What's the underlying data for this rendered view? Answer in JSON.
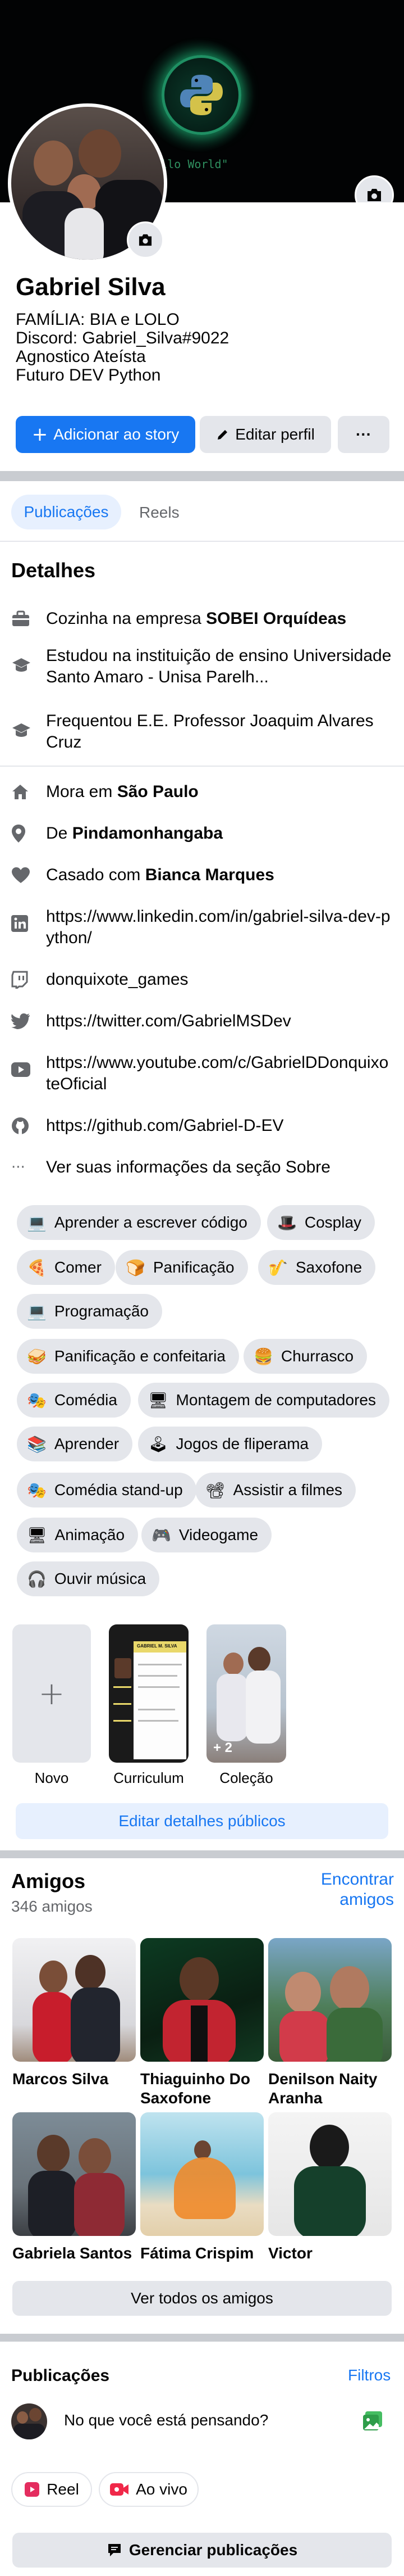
{
  "cover": {
    "code_text": "t \"Hello World\""
  },
  "profile": {
    "name": "Gabriel Silva",
    "bio": [
      "FAMÍLIA: BIA e LOLO",
      "Discord: Gabriel_Silva#9022",
      "Agnostico Ateísta",
      "Futuro DEV Python"
    ],
    "add_story": "Adicionar ao story",
    "edit_profile": "Editar perfil",
    "more": "···"
  },
  "tabs": {
    "posts": "Publicações",
    "reels": "Reels"
  },
  "details": {
    "heading": "Detalhes",
    "work_prefix": "Cozinha na empresa ",
    "work_company": "SOBEI Orquídeas",
    "study1": "Estudou na instituição de ensino Universidade Santo Amaro - Unisa Parelh...",
    "study2": "Frequentou E.E. Professor Joaquim Alvares Cruz",
    "lives_prefix": "Mora em ",
    "lives_city": "São Paulo",
    "from_prefix": "De ",
    "from_city": "Pindamonhangaba",
    "married_prefix": "Casado com ",
    "married_name": "Bianca Marques",
    "linkedin": "https://www.linkedin.com/in/gabriel-silva-dev-python/",
    "twitch": "donquixote_games",
    "twitter": "https://twitter.com/GabrielMSDev",
    "youtube": "https://www.youtube.com/c/GabrielDDonquixoteOficial",
    "github": "https://github.com/Gabriel-D-EV",
    "about": "Ver suas informações da seção Sobre"
  },
  "hobbies": [
    {
      "emoji": "💻",
      "label": "Aprender a escrever código"
    },
    {
      "emoji": "🎩",
      "label": "Cosplay"
    },
    {
      "emoji": "🍕",
      "label": "Comer"
    },
    {
      "emoji": "🍞",
      "label": "Panificação"
    },
    {
      "emoji": "🎷",
      "label": "Saxofone"
    },
    {
      "emoji": "💻",
      "label": "Programação"
    },
    {
      "emoji": "🥪",
      "label": "Panificação e confeitaria"
    },
    {
      "emoji": "🍔",
      "label": "Churrasco"
    },
    {
      "emoji": "🎭",
      "label": "Comédia"
    },
    {
      "emoji": "🖥",
      "label": "Montagem de computadores"
    },
    {
      "emoji": "📚",
      "label": "Aprender"
    },
    {
      "emoji": "🕹",
      "label": "Jogos de fliperama"
    },
    {
      "emoji": "🎭",
      "label": "Comédia stand-up"
    },
    {
      "emoji": "📽",
      "label": "Assistir a filmes"
    },
    {
      "emoji": "🖥",
      "label": "Animação"
    },
    {
      "emoji": "🎮",
      "label": "Videogame"
    },
    {
      "emoji": "🎧",
      "label": "Ouvir música"
    }
  ],
  "featured": {
    "new": "Novo",
    "curriculum": "Curriculum",
    "collection": "Coleção",
    "collection_count": "+ 2",
    "doc_name": "GABRIEL M. SILVA",
    "edit_public": "Editar detalhes públicos"
  },
  "friends": {
    "heading": "Amigos",
    "count": "346 amigos",
    "find": "Encontrar amigos",
    "list": [
      {
        "name": "Marcos Silva"
      },
      {
        "name": "Thiaguinho Do Saxofone"
      },
      {
        "name": "Denilson Naity Aranha"
      },
      {
        "name": "Gabriela Santos"
      },
      {
        "name": "Fátima Crispim"
      },
      {
        "name": "Victor"
      }
    ],
    "see_all": "Ver todos os amigos"
  },
  "posts": {
    "heading": "Publicações",
    "filters": "Filtros",
    "composer": "No que você está pensando?",
    "reel": "Reel",
    "live": "Ao vivo",
    "manage": "Gerenciar publicações"
  },
  "colors": {
    "accent": "#1877f2",
    "chip": "#e4e6eb",
    "separator": "#c9ccd1"
  }
}
